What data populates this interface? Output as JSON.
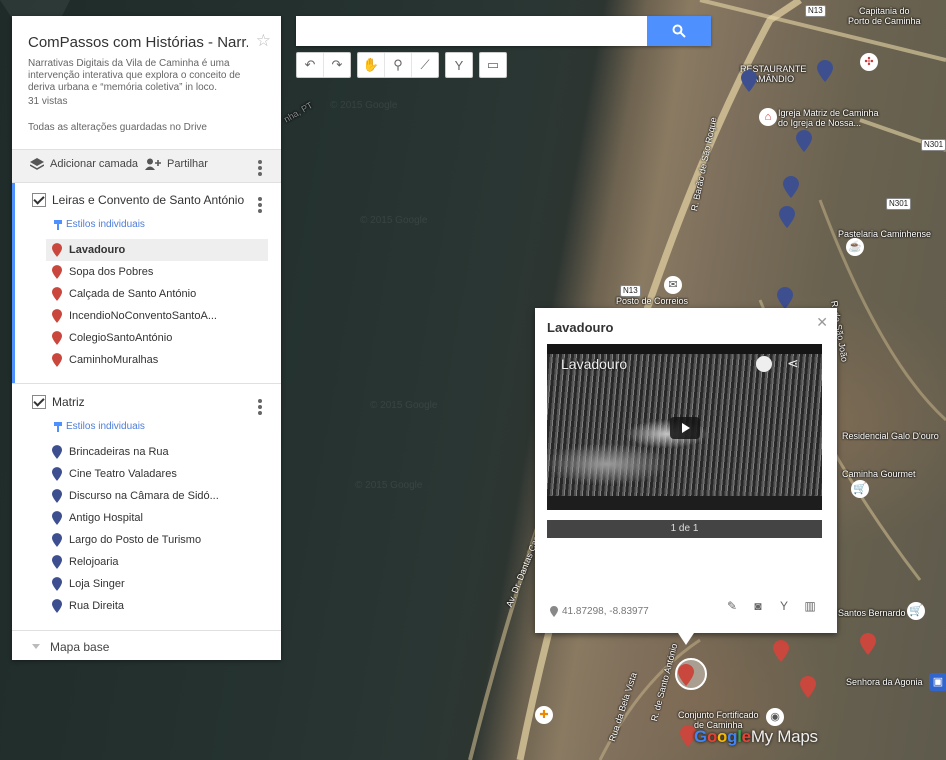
{
  "search": {
    "placeholder": ""
  },
  "panel": {
    "title": "ComPassos com Histórias - Narr...",
    "description": "Narrativas Digitais da Vila de Caminha é uma intervenção interativa que explora o conceito de deriva urbana e “memória coletiva” in loco.",
    "views": "31 vistas",
    "saved": "Todas as alterações guardadas no Drive",
    "add_layer": "Adicionar camada",
    "share": "Partilhar",
    "layers": [
      {
        "name": "Leiras e Convento de Santo António",
        "styles": "Estilos individuais",
        "color": "#c9473c",
        "items": [
          "Lavadouro",
          "Sopa dos Pobres",
          "Calçada de Santo António",
          "IncendioNoConventoSantoA...",
          "ColegioSantoAntónio",
          "CaminhoMuralhas"
        ]
      },
      {
        "name": "Matriz",
        "styles": "Estilos individuais",
        "color": "#3d4f8f",
        "items": [
          "Brincadeiras na Rua",
          "Cine Teatro Valadares",
          "Discurso na Câmara de Sidó...",
          "Antigo Hospital",
          "Largo do Posto de Turismo",
          "Relojoaria",
          "Loja Singer",
          "Rua Direita"
        ]
      }
    ],
    "base_map": "Mapa base"
  },
  "info_window": {
    "title": "Lavadouro",
    "video_title": "Lavadouro",
    "pager": "1 de 1",
    "coords": "41.87298, -8.83977"
  },
  "map": {
    "labels": {
      "n13_a": "N13",
      "n13_b": "N13",
      "n301_a": "N301",
      "n301_b": "N301",
      "capitania": "Capitania do\nPorto de Caminha",
      "restaurante": "RESTAURANTE\nAMÂNDIO",
      "igreja": "Igreja Matriz de Caminha\ndo Igreja de Nossa...",
      "rua_sao_roque": "R. Barão de São Roque",
      "pastelaria": "Pastelaria Caminhense",
      "correios": "Posto de Correios",
      "residencial": "Residencial Galo D'ouro",
      "gourmet": "Caminha Gourmet",
      "santos": "Santos Bernardo",
      "senhora": "Senhora da Agonia",
      "conjunto": "Conjunto Fortificado\nde Caminha",
      "avenida": "Av. Dr. Dantas Carneiro",
      "rua_bela_vista": "Rua da Bela Vista",
      "rua_sao_joao": "R. de São João",
      "rua_santo_antonio": "R. de Santo António",
      "pt": "nha, PT",
      "watermark": "© 2015 Google"
    },
    "brand": {
      "google": [
        "G",
        "o",
        "o",
        "g",
        "l",
        "e"
      ],
      "my_maps": "My Maps"
    }
  },
  "colors": {
    "accent": "#4d90fe",
    "red_marker": "#c9473c",
    "blue_marker": "#3d4f8f"
  }
}
